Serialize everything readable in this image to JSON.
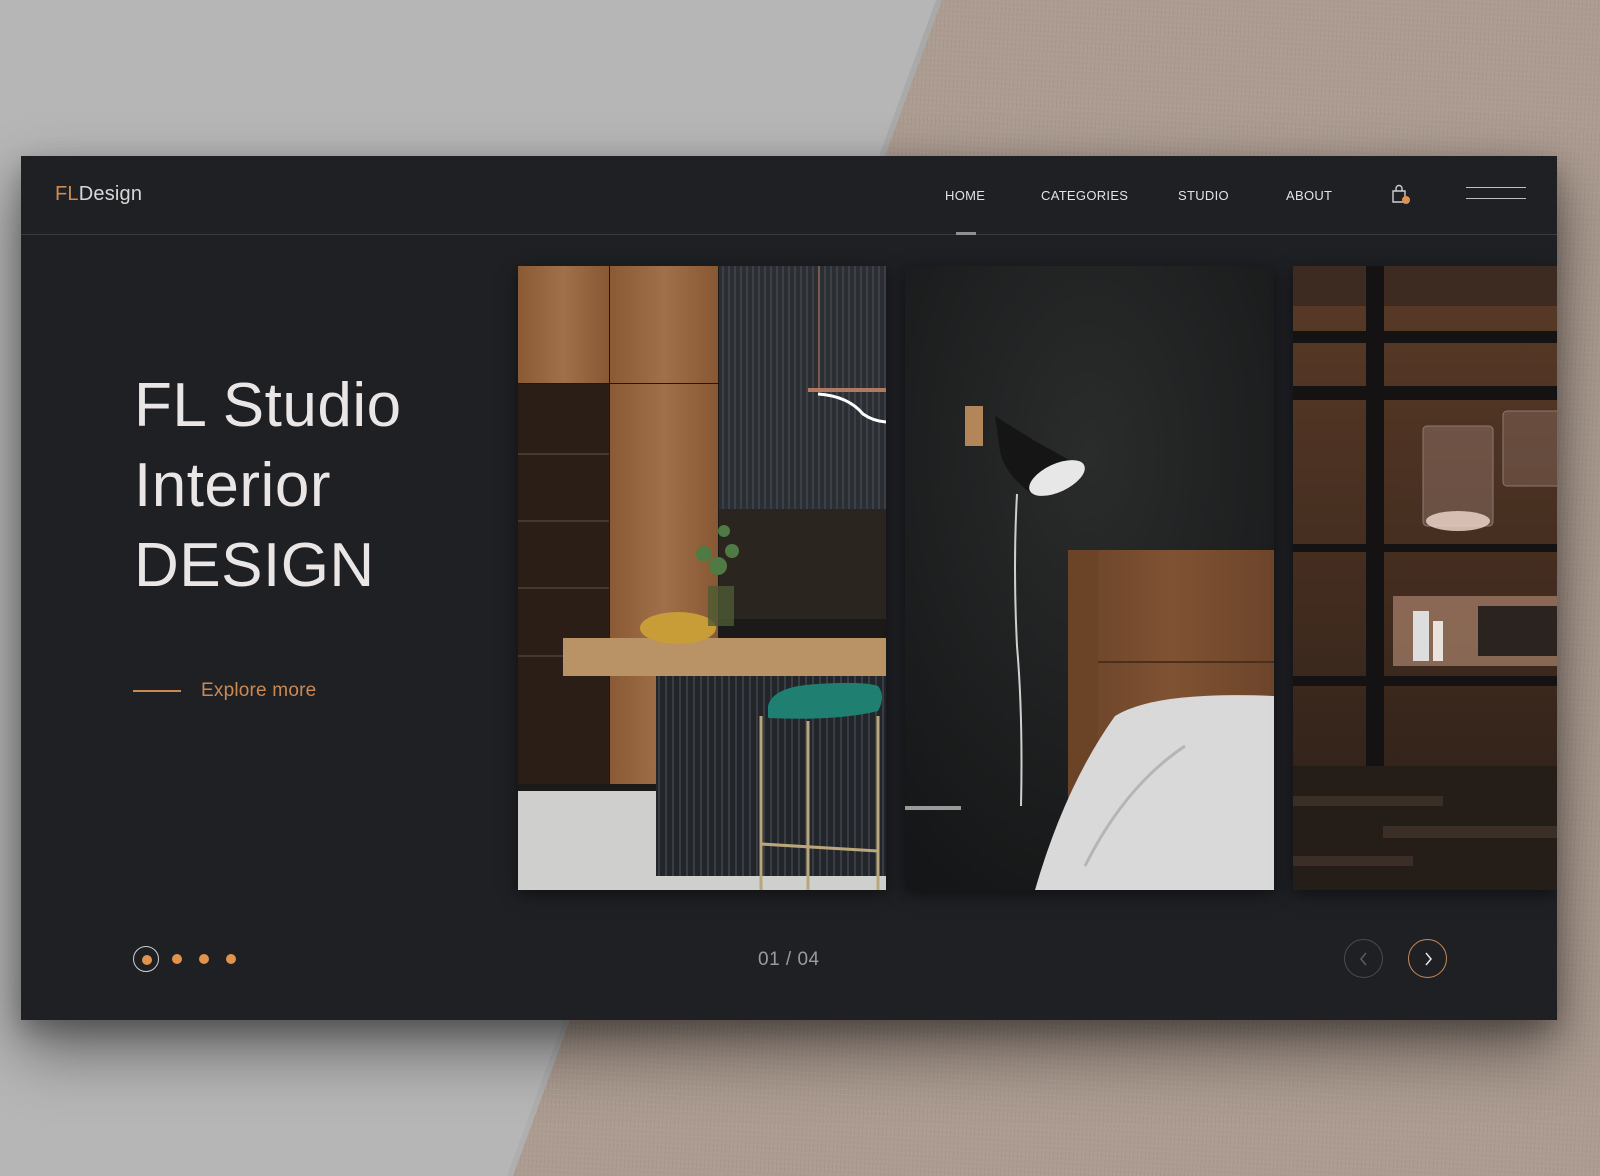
{
  "brand": {
    "prefix": "FL",
    "suffix": "Design",
    "accent_color": "#d08a4e"
  },
  "nav": {
    "items": [
      {
        "label": "HOME",
        "active": true
      },
      {
        "label": "CATEGORIES",
        "active": false
      },
      {
        "label": "STUDIO",
        "active": false
      },
      {
        "label": "ABOUT",
        "active": false
      }
    ],
    "cart_icon": "shopping-bag-icon",
    "cart_has_badge": true,
    "menu_icon": "hamburger-menu-icon"
  },
  "hero": {
    "title_lines": [
      "FL Studio",
      "Interior",
      "DESIGN"
    ],
    "cta_label": "Explore more"
  },
  "slides": [
    {
      "name": "kitchen",
      "description": "Kitchen with wood cabinets, fluted island and teal bar stool"
    },
    {
      "name": "bedroom",
      "description": "Dark bedroom with wall lamp and wooden headboard"
    },
    {
      "name": "living-room",
      "description": "Night view through window of living room with chandeliers"
    }
  ],
  "pagination": {
    "current": 1,
    "total": 4,
    "counter_text": "01 / 04"
  },
  "controls": {
    "prev_icon": "chevron-left-icon",
    "next_icon": "chevron-right-icon"
  },
  "colors": {
    "card_bg": "#1f2024",
    "accent": "#e0934c",
    "cta": "#c98a52",
    "text_primary": "#ebe6e6",
    "text_muted": "#9b9b9e"
  }
}
